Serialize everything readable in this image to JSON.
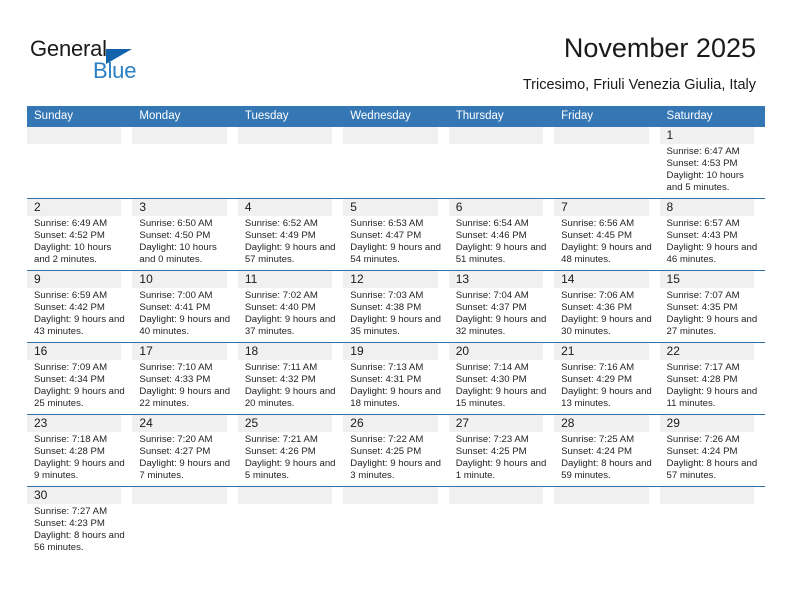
{
  "brand": {
    "name_top": "General",
    "name_bottom": "Blue",
    "accent_color": "#1263ac",
    "blue_text_color": "#2b7fc4"
  },
  "header": {
    "title": "November 2025",
    "subtitle": "Tricesimo, Friuli Venezia Giulia, Italy"
  },
  "calendar": {
    "header_bg": "#3577b5",
    "row_border": "#2f6fae",
    "day_strip_bg": "#f0f0f0",
    "weekdays": [
      "Sunday",
      "Monday",
      "Tuesday",
      "Wednesday",
      "Thursday",
      "Friday",
      "Saturday"
    ],
    "weeks": [
      [
        {
          "day": "",
          "sunrise": "",
          "sunset": "",
          "daylight": "",
          "empty": true
        },
        {
          "day": "",
          "sunrise": "",
          "sunset": "",
          "daylight": "",
          "empty": true
        },
        {
          "day": "",
          "sunrise": "",
          "sunset": "",
          "daylight": "",
          "empty": true
        },
        {
          "day": "",
          "sunrise": "",
          "sunset": "",
          "daylight": "",
          "empty": true
        },
        {
          "day": "",
          "sunrise": "",
          "sunset": "",
          "daylight": "",
          "empty": true
        },
        {
          "day": "",
          "sunrise": "",
          "sunset": "",
          "daylight": "",
          "empty": true
        },
        {
          "day": "1",
          "sunrise": "Sunrise: 6:47 AM",
          "sunset": "Sunset: 4:53 PM",
          "daylight": "Daylight: 10 hours and 5 minutes."
        }
      ],
      [
        {
          "day": "2",
          "sunrise": "Sunrise: 6:49 AM",
          "sunset": "Sunset: 4:52 PM",
          "daylight": "Daylight: 10 hours and 2 minutes."
        },
        {
          "day": "3",
          "sunrise": "Sunrise: 6:50 AM",
          "sunset": "Sunset: 4:50 PM",
          "daylight": "Daylight: 10 hours and 0 minutes."
        },
        {
          "day": "4",
          "sunrise": "Sunrise: 6:52 AM",
          "sunset": "Sunset: 4:49 PM",
          "daylight": "Daylight: 9 hours and 57 minutes."
        },
        {
          "day": "5",
          "sunrise": "Sunrise: 6:53 AM",
          "sunset": "Sunset: 4:47 PM",
          "daylight": "Daylight: 9 hours and 54 minutes."
        },
        {
          "day": "6",
          "sunrise": "Sunrise: 6:54 AM",
          "sunset": "Sunset: 4:46 PM",
          "daylight": "Daylight: 9 hours and 51 minutes."
        },
        {
          "day": "7",
          "sunrise": "Sunrise: 6:56 AM",
          "sunset": "Sunset: 4:45 PM",
          "daylight": "Daylight: 9 hours and 48 minutes."
        },
        {
          "day": "8",
          "sunrise": "Sunrise: 6:57 AM",
          "sunset": "Sunset: 4:43 PM",
          "daylight": "Daylight: 9 hours and 46 minutes."
        }
      ],
      [
        {
          "day": "9",
          "sunrise": "Sunrise: 6:59 AM",
          "sunset": "Sunset: 4:42 PM",
          "daylight": "Daylight: 9 hours and 43 minutes."
        },
        {
          "day": "10",
          "sunrise": "Sunrise: 7:00 AM",
          "sunset": "Sunset: 4:41 PM",
          "daylight": "Daylight: 9 hours and 40 minutes."
        },
        {
          "day": "11",
          "sunrise": "Sunrise: 7:02 AM",
          "sunset": "Sunset: 4:40 PM",
          "daylight": "Daylight: 9 hours and 37 minutes."
        },
        {
          "day": "12",
          "sunrise": "Sunrise: 7:03 AM",
          "sunset": "Sunset: 4:38 PM",
          "daylight": "Daylight: 9 hours and 35 minutes."
        },
        {
          "day": "13",
          "sunrise": "Sunrise: 7:04 AM",
          "sunset": "Sunset: 4:37 PM",
          "daylight": "Daylight: 9 hours and 32 minutes."
        },
        {
          "day": "14",
          "sunrise": "Sunrise: 7:06 AM",
          "sunset": "Sunset: 4:36 PM",
          "daylight": "Daylight: 9 hours and 30 minutes."
        },
        {
          "day": "15",
          "sunrise": "Sunrise: 7:07 AM",
          "sunset": "Sunset: 4:35 PM",
          "daylight": "Daylight: 9 hours and 27 minutes."
        }
      ],
      [
        {
          "day": "16",
          "sunrise": "Sunrise: 7:09 AM",
          "sunset": "Sunset: 4:34 PM",
          "daylight": "Daylight: 9 hours and 25 minutes."
        },
        {
          "day": "17",
          "sunrise": "Sunrise: 7:10 AM",
          "sunset": "Sunset: 4:33 PM",
          "daylight": "Daylight: 9 hours and 22 minutes."
        },
        {
          "day": "18",
          "sunrise": "Sunrise: 7:11 AM",
          "sunset": "Sunset: 4:32 PM",
          "daylight": "Daylight: 9 hours and 20 minutes."
        },
        {
          "day": "19",
          "sunrise": "Sunrise: 7:13 AM",
          "sunset": "Sunset: 4:31 PM",
          "daylight": "Daylight: 9 hours and 18 minutes."
        },
        {
          "day": "20",
          "sunrise": "Sunrise: 7:14 AM",
          "sunset": "Sunset: 4:30 PM",
          "daylight": "Daylight: 9 hours and 15 minutes."
        },
        {
          "day": "21",
          "sunrise": "Sunrise: 7:16 AM",
          "sunset": "Sunset: 4:29 PM",
          "daylight": "Daylight: 9 hours and 13 minutes."
        },
        {
          "day": "22",
          "sunrise": "Sunrise: 7:17 AM",
          "sunset": "Sunset: 4:28 PM",
          "daylight": "Daylight: 9 hours and 11 minutes."
        }
      ],
      [
        {
          "day": "23",
          "sunrise": "Sunrise: 7:18 AM",
          "sunset": "Sunset: 4:28 PM",
          "daylight": "Daylight: 9 hours and 9 minutes."
        },
        {
          "day": "24",
          "sunrise": "Sunrise: 7:20 AM",
          "sunset": "Sunset: 4:27 PM",
          "daylight": "Daylight: 9 hours and 7 minutes."
        },
        {
          "day": "25",
          "sunrise": "Sunrise: 7:21 AM",
          "sunset": "Sunset: 4:26 PM",
          "daylight": "Daylight: 9 hours and 5 minutes."
        },
        {
          "day": "26",
          "sunrise": "Sunrise: 7:22 AM",
          "sunset": "Sunset: 4:25 PM",
          "daylight": "Daylight: 9 hours and 3 minutes."
        },
        {
          "day": "27",
          "sunrise": "Sunrise: 7:23 AM",
          "sunset": "Sunset: 4:25 PM",
          "daylight": "Daylight: 9 hours and 1 minute."
        },
        {
          "day": "28",
          "sunrise": "Sunrise: 7:25 AM",
          "sunset": "Sunset: 4:24 PM",
          "daylight": "Daylight: 8 hours and 59 minutes."
        },
        {
          "day": "29",
          "sunrise": "Sunrise: 7:26 AM",
          "sunset": "Sunset: 4:24 PM",
          "daylight": "Daylight: 8 hours and 57 minutes."
        }
      ],
      [
        {
          "day": "30",
          "sunrise": "Sunrise: 7:27 AM",
          "sunset": "Sunset: 4:23 PM",
          "daylight": "Daylight: 8 hours and 56 minutes."
        },
        {
          "day": "",
          "sunrise": "",
          "sunset": "",
          "daylight": "",
          "empty": true
        },
        {
          "day": "",
          "sunrise": "",
          "sunset": "",
          "daylight": "",
          "empty": true
        },
        {
          "day": "",
          "sunrise": "",
          "sunset": "",
          "daylight": "",
          "empty": true
        },
        {
          "day": "",
          "sunrise": "",
          "sunset": "",
          "daylight": "",
          "empty": true
        },
        {
          "day": "",
          "sunrise": "",
          "sunset": "",
          "daylight": "",
          "empty": true
        },
        {
          "day": "",
          "sunrise": "",
          "sunset": "",
          "daylight": "",
          "empty": true
        }
      ]
    ]
  }
}
